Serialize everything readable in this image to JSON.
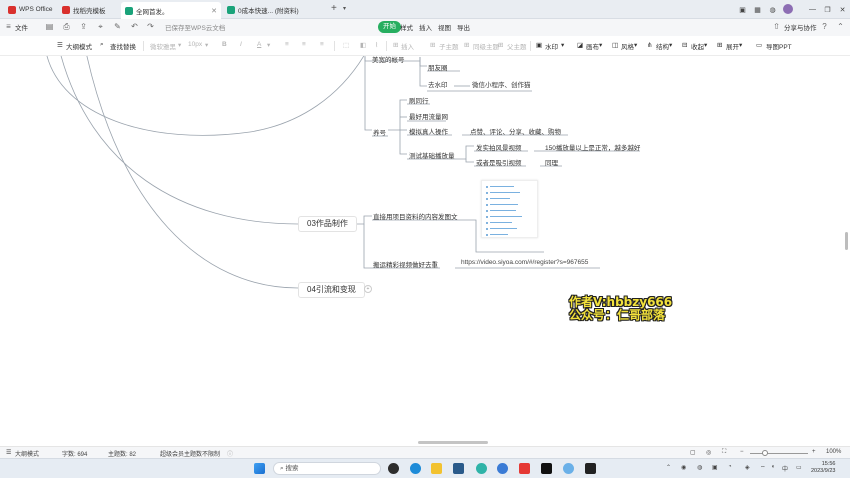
{
  "tabs": [
    {
      "label": "WPS Office",
      "color": "#d9302d"
    },
    {
      "label": "找稻壳模板",
      "color": "#d9302d"
    },
    {
      "label": "全网首发。",
      "color": "#1aa37a"
    },
    {
      "label": "0成本快速... (附资料)",
      "color": "#1aa37a"
    }
  ],
  "menu": {
    "file": "文件",
    "mode_hint": "已保存至WPS云文档",
    "start": "开始",
    "items": [
      "样式",
      "插入",
      "视图",
      "导出"
    ],
    "share": "分享与协作"
  },
  "toolbar": {
    "outline": "大纲模式",
    "find": "查找替换",
    "font": "微软雅黑",
    "size": "10px",
    "bold": "B",
    "italic": "I",
    "color": "A",
    "disabled": [
      "插入",
      "子主题",
      "同级主题",
      "父主题",
      "关联"
    ],
    "items": [
      "水印",
      "画布",
      "风格",
      "结构",
      "收起",
      "展开",
      "导图PPT"
    ]
  },
  "mindmap": {
    "nodes": {
      "top_cut": "美宽的帐号",
      "n_pyq": "朋友圈",
      "n_qsy": "去水印",
      "n_qsy_child": "微信小程序、创作猫",
      "n_yh": "养号",
      "n_jlx": "刷同行",
      "n_zhyj": "最好用流量网",
      "n_mnzr": "模拟真人操作",
      "n_mnzr_child": "点赞、评论、分享、收藏、购物",
      "n_csjc": "测试基础播放量",
      "n_fszp": "发实拍风景视频",
      "n_fszp_child": "150播放量以上是正常，越多越好",
      "n_hzgx": "或者是吸引视频",
      "n_hzgx_child": "同理",
      "n_zpzz": "03作品制作",
      "n_zsy": "直接用项目资料的内容发图文",
      "n_jxzp": "搬运精彩视频做好去重",
      "n_url": "https://video.siyoa.com/#/register?s=967655",
      "n_ylbx": "04引流和变现"
    }
  },
  "watermark": {
    "line1": "作者V:hbbzy666",
    "line2": "公众号：仁哥部落"
  },
  "statusbar": {
    "outline": "大纲模式",
    "words": "字数: 694",
    "topics": "主题数: 82",
    "notice": "超级会员主题数不限制",
    "zoom": "100%"
  },
  "taskbar": {
    "search_placeholder": "搜索",
    "time": "15:56",
    "date": "2023/9/23",
    "lang": "中"
  }
}
